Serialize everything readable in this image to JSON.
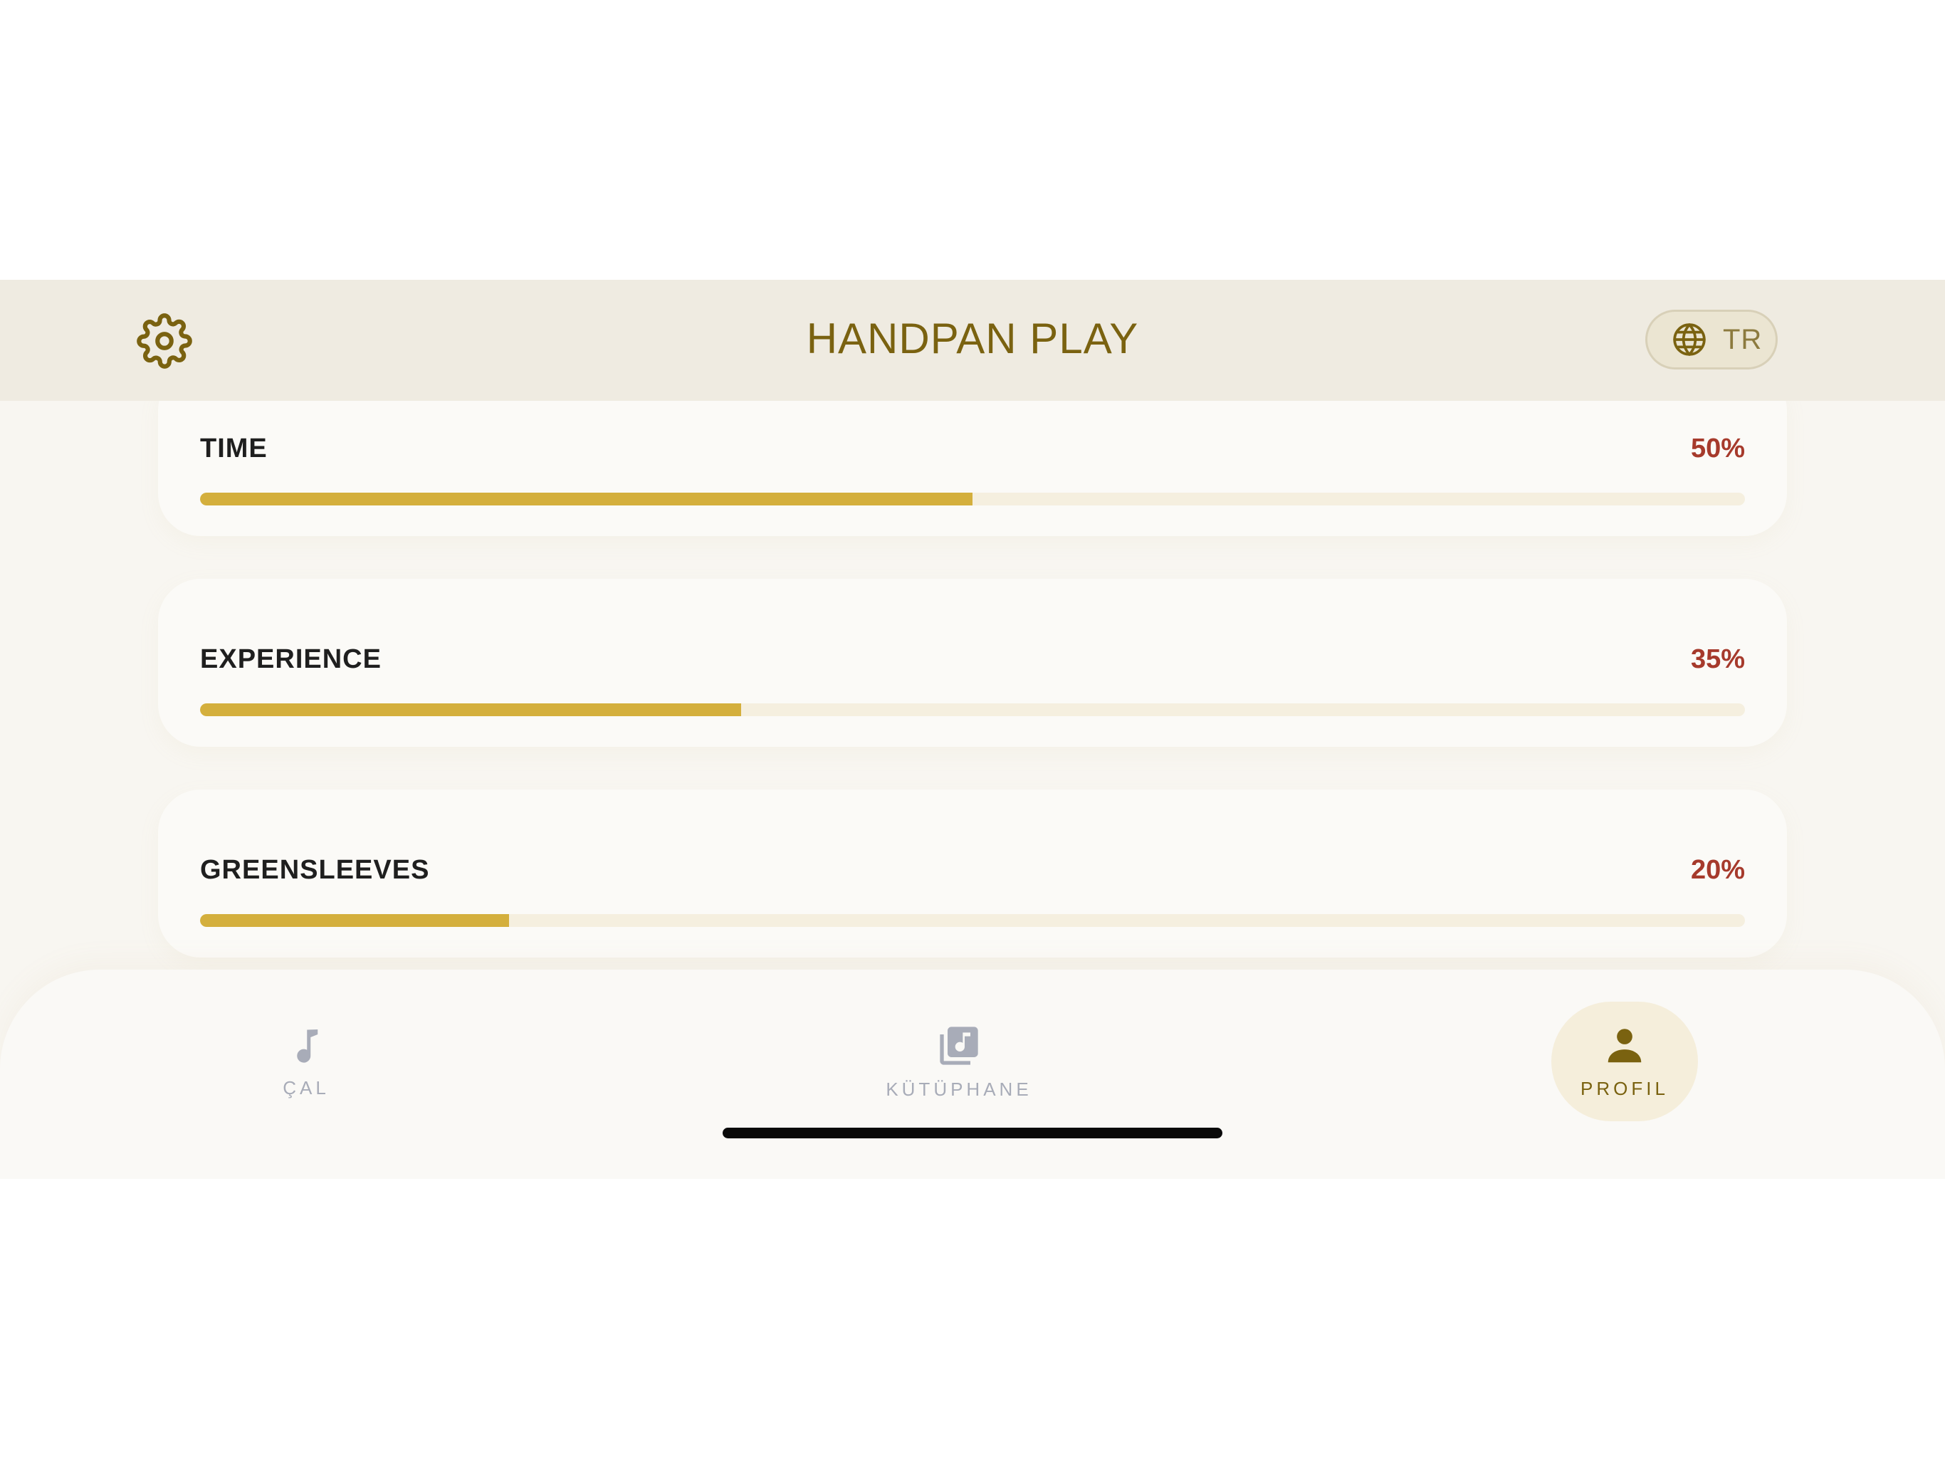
{
  "header": {
    "title": "HANDPAN PLAY",
    "settings_icon": "gear-icon",
    "language": {
      "icon": "globe-icon",
      "code": "TR"
    }
  },
  "progress": {
    "items": [
      {
        "name": "TIME",
        "percent_label": "50%",
        "value": 0.5
      },
      {
        "name": "EXPERIENCE",
        "percent_label": "35%",
        "value": 0.35
      },
      {
        "name": "GREENSLEEVES",
        "percent_label": "20%",
        "value": 0.2
      }
    ]
  },
  "tabbar": {
    "tabs": [
      {
        "label": "ÇAL",
        "icon": "music-note-icon",
        "active": false
      },
      {
        "label": "KÜTÜPHANE",
        "icon": "music-library-icon",
        "active": false
      },
      {
        "label": "PROFIL",
        "icon": "person-icon",
        "active": true
      }
    ]
  },
  "colors": {
    "accent": "#d4af3d",
    "brand_text": "#7a6210",
    "percent_text": "#a63a2c",
    "track": "#f5efdf",
    "inactive_tab": "#a8acb8"
  }
}
